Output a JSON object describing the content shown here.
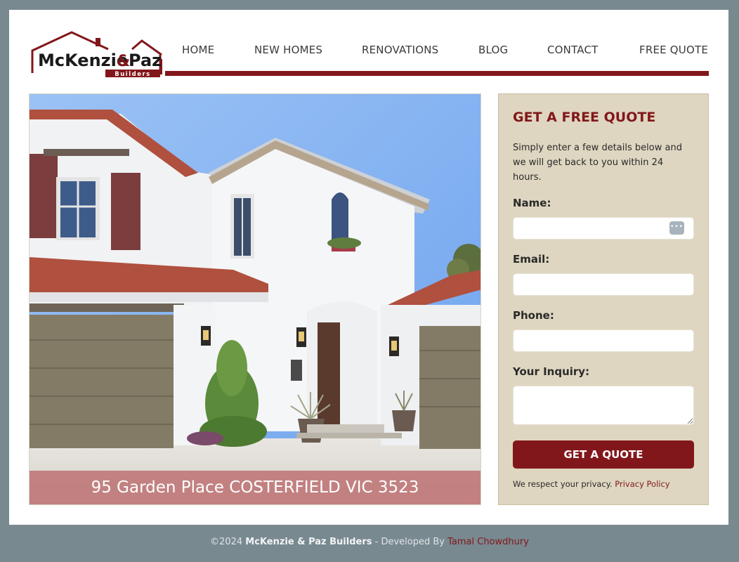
{
  "brand": {
    "logo_text_main": "McKenzie",
    "logo_text_amp": "&",
    "logo_text_paz": "Paz",
    "logo_text_sub": "Builders",
    "colors": {
      "maroon": "#82171b",
      "panel": "#ded6c0",
      "backdrop": "#798990"
    }
  },
  "nav": {
    "items": [
      {
        "label": "HOME"
      },
      {
        "label": "NEW HOMES"
      },
      {
        "label": "RENOVATIONS"
      },
      {
        "label": "BLOG"
      },
      {
        "label": "CONTACT"
      },
      {
        "label": "FREE QUOTE"
      }
    ]
  },
  "hero": {
    "caption": "95 Garden Place COSTERFIELD VIC 3523"
  },
  "quote_form": {
    "title": "GET A FREE QUOTE",
    "description": "Simply enter a few details below and we will get back to you within 24 hours.",
    "fields": {
      "name": {
        "label": "Name:",
        "value": ""
      },
      "email": {
        "label": "Email:",
        "value": ""
      },
      "phone": {
        "label": "Phone:",
        "value": ""
      },
      "inquiry": {
        "label": "Your Inquiry:",
        "value": ""
      }
    },
    "submit_label": "GET A QUOTE",
    "privacy_text": "We respect your privacy.",
    "privacy_link": "Privacy Policy"
  },
  "footer": {
    "copyright": "©2024",
    "company": "McKenzie & Paz Builders",
    "developed_by": "- Developed By",
    "developer": "Tamal Chowdhury"
  }
}
